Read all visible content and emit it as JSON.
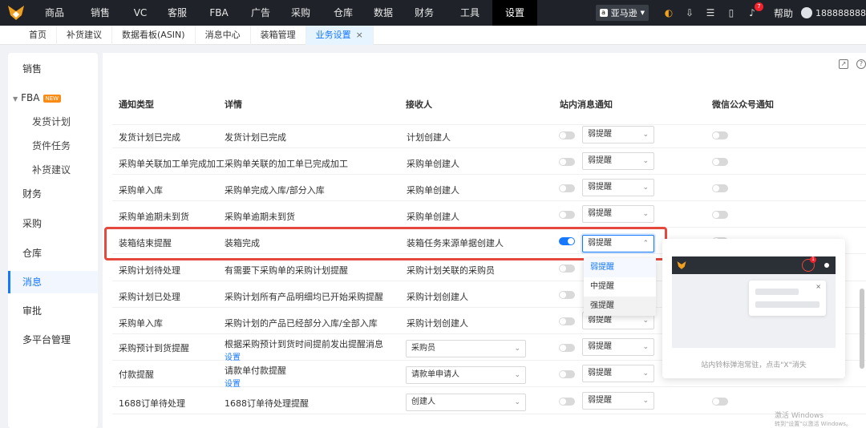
{
  "nav": {
    "items": [
      "商品",
      "销售",
      "VC",
      "客服",
      "FBA",
      "广告",
      "采购",
      "仓库",
      "数据",
      "财务",
      "工具",
      "设置"
    ],
    "active_index": 11,
    "platform": "亚马逊",
    "bell_count": "7",
    "help": "帮助",
    "user": "188888888"
  },
  "tabs": [
    {
      "label": "首页"
    },
    {
      "label": "补货建议"
    },
    {
      "label": "数据看板(ASIN)"
    },
    {
      "label": "消息中心"
    },
    {
      "label": "装箱管理"
    },
    {
      "label": "业务设置",
      "active": true,
      "close": "×"
    }
  ],
  "sidebar": {
    "items": [
      {
        "label": "销售"
      },
      {
        "label": "FBA",
        "badge": "NEW"
      },
      {
        "label": "发货计划"
      },
      {
        "label": "货件任务"
      },
      {
        "label": "补货建议"
      },
      {
        "label": "财务"
      },
      {
        "label": "采购"
      },
      {
        "label": "仓库"
      },
      {
        "label": "消息",
        "active": true
      },
      {
        "label": "审批"
      },
      {
        "label": "多平台管理"
      }
    ]
  },
  "table": {
    "headers": [
      "通知类型",
      "详情",
      "接收人",
      "站内消息通知",
      "微信公众号通知"
    ],
    "rows": [
      {
        "type": "发货计划已完成",
        "detail": "发货计划已完成",
        "receiver": "计划创建人",
        "site_on": false,
        "level": "弱提醒",
        "wechat_on": false
      },
      {
        "type": "采购单关联加工单完成加工",
        "detail": "采购单关联的加工单已完成加工",
        "receiver": "采购单创建人",
        "site_on": false,
        "level": "弱提醒",
        "wechat_on": false
      },
      {
        "type": "采购单入库",
        "detail": "采购单完成入库/部分入库",
        "receiver": "采购单创建人",
        "site_on": false,
        "level": "弱提醒",
        "wechat_on": false
      },
      {
        "type": "采购单逾期未到货",
        "detail": "采购单逾期未到货",
        "receiver": "采购单创建人",
        "site_on": false,
        "level": "弱提醒",
        "wechat_on": false
      },
      {
        "type": "装箱结束提醒",
        "detail": "装箱完成",
        "receiver": "装箱任务来源单据创建人",
        "site_on": true,
        "level": "弱提醒",
        "wechat_on": false
      },
      {
        "type": "采购计划待处理",
        "detail": "有需要下采购单的采购计划提醒",
        "receiver": "采购计划关联的采购员",
        "site_on": false,
        "level": "",
        "wechat_on": false
      },
      {
        "type": "采购计划已处理",
        "detail": "采购计划所有产品明细均已开始采购提醒",
        "receiver": "采购计划创建人",
        "site_on": false,
        "level": "",
        "wechat_on": false
      },
      {
        "type": "采购单入库",
        "detail": "采购计划的产品已经部分入库/全部入库",
        "receiver": "采购计划创建人",
        "site_on": false,
        "level": "弱提醒",
        "wechat_on": false
      },
      {
        "type": "采购预计到货提醒",
        "detail": "根据采购预计到货时间提前发出提醒消息",
        "detail_link": "设置",
        "receiver_select": "采购员",
        "site_on": false,
        "level": "弱提醒",
        "wechat_on": false
      },
      {
        "type": "付款提醒",
        "detail": "请款单付款提醒",
        "detail_link": "设置",
        "receiver_select": "请款单申请人",
        "site_on": false,
        "level": "弱提醒",
        "wechat_on": false
      },
      {
        "type": "1688订单待处理",
        "detail": "1688订单待处理提醒",
        "receiver_select": "创建人",
        "site_on": false,
        "level": "弱提醒",
        "wechat_on": false
      }
    ]
  },
  "dropdown": {
    "options": [
      "弱提醒",
      "中提醒",
      "强提醒"
    ],
    "selected_index": 0,
    "hover_index": 2
  },
  "preview": {
    "caption": "站内铃标弹泡常驻，点击\"X\"消失",
    "badge": "1",
    "close": "×"
  },
  "watermark": {
    "line1": "激活 Windows",
    "line2": "转到\"设置\"以激活 Windows。"
  },
  "colors": {
    "accent": "#1677ff",
    "nav_bg": "#1f2329",
    "highlight": "#e5483c"
  }
}
